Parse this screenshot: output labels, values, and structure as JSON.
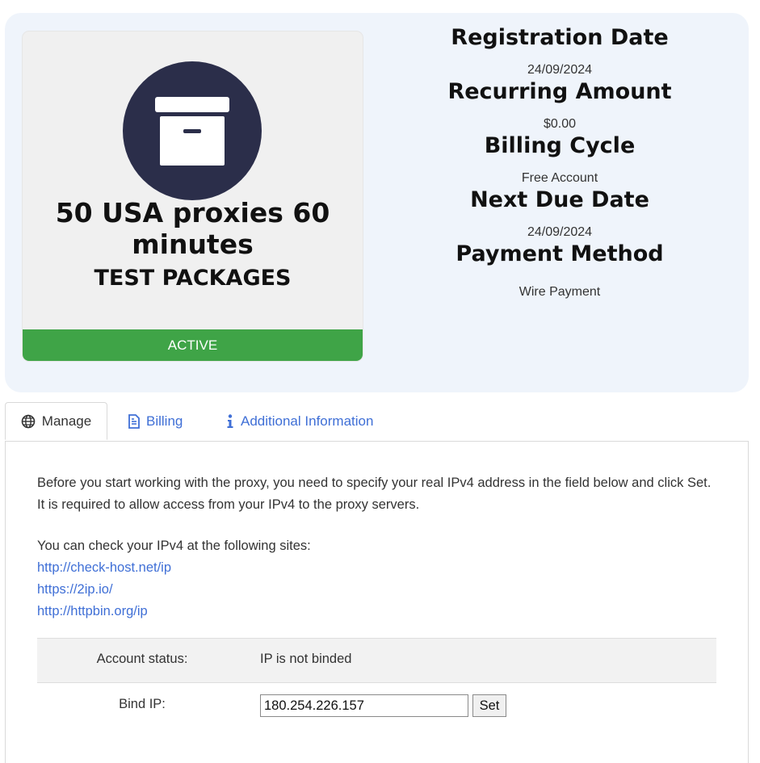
{
  "product": {
    "name": "50 USA proxies 60 minutes",
    "group": "TEST PACKAGES",
    "status": "ACTIVE",
    "icon": "archive-box-icon"
  },
  "details": [
    {
      "label": "Registration Date",
      "value": "24/09/2024"
    },
    {
      "label": "Recurring Amount",
      "value": "$0.00"
    },
    {
      "label": "Billing Cycle",
      "value": "Free Account"
    },
    {
      "label": "Next Due Date",
      "value": "24/09/2024"
    },
    {
      "label": "Payment Method",
      "value": "Wire Payment"
    }
  ],
  "tabs": [
    {
      "label": "Manage",
      "icon": "globe-icon",
      "active": true
    },
    {
      "label": "Billing",
      "icon": "document-icon",
      "active": false
    },
    {
      "label": "Additional Information",
      "icon": "info-icon",
      "active": false
    }
  ],
  "manage": {
    "intro": "Before you start working with the proxy, you need to specify your real IPv4 address in the field below and click Set. It is required to allow access from your IPv4 to the proxy servers.",
    "check_text": "You can check your IPv4 at the following sites:",
    "links": [
      "http://check-host.net/ip",
      "https://2ip.io/",
      "http://httpbin.org/ip"
    ],
    "account_status_label": "Account status:",
    "account_status_value": "IP is not binded",
    "bind_ip_label": "Bind IP:",
    "bind_ip_value": "180.254.226.157",
    "set_button": "Set"
  },
  "colors": {
    "accent": "#3f6fd6",
    "status_active": "#3fa447",
    "icon_circle": "#2b2e4a",
    "panel_bg": "#eff4fb"
  }
}
